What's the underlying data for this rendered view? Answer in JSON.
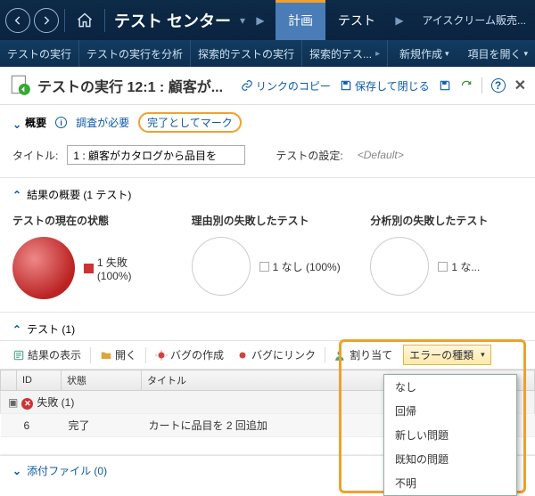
{
  "topbar": {
    "title": "テスト センター",
    "overflow": "アイスクリーム販売..."
  },
  "topTabs": {
    "plan": "計画",
    "test": "テスト"
  },
  "subbar": {
    "run": "テストの実行",
    "analyze": "テストの実行を分析",
    "exploratory": "探索的テストの実行",
    "exploratory_trunc": "探索的テス...",
    "create": "新規作成",
    "open": "項目を開く"
  },
  "editor": {
    "title": "テストの実行 12:1 : 顧客が...",
    "copyLink": "リンクのコピー",
    "saveClose": "保存して閉じる"
  },
  "summary": {
    "overview": "概要",
    "investigate": "調査が必要",
    "markDone": "完了としてマーク"
  },
  "titlerow": {
    "titleLabel": "タイトル:",
    "titleValue": "1 : 顧客がカタログから品目を",
    "settingsLabel": "テストの設定:",
    "settingsValue": "<Default>"
  },
  "results": {
    "heading": "結果の概要 (1 テスト)"
  },
  "status": {
    "col1": {
      "h": "テストの現在の状態",
      "legend": "1 失敗 (100%)"
    },
    "col2": {
      "h": "理由別の失敗したテスト",
      "legend": "1 なし (100%)"
    },
    "col3": {
      "h": "分析別の失敗したテスト",
      "legend": "1 な..."
    }
  },
  "tests": {
    "heading": "テスト (1)"
  },
  "toolbar2": {
    "showResults": "結果の表示",
    "open": "開く",
    "createBug": "バグの作成",
    "linkBug": "バグにリンク",
    "assign": "割り当て",
    "errorType": "エラーの種類"
  },
  "table": {
    "cols": {
      "id": "ID",
      "state": "状態",
      "title": "タイトル"
    },
    "group": "失敗 (1)",
    "row": {
      "id": "6",
      "state": "完了",
      "title": "カートに品目を 2 回追加"
    }
  },
  "menu": {
    "none": "なし",
    "reg": "回帰",
    "new": "新しい問題",
    "known": "既知の問題",
    "unknown": "不明"
  },
  "attach": {
    "heading": "添付ファイル (0)"
  }
}
